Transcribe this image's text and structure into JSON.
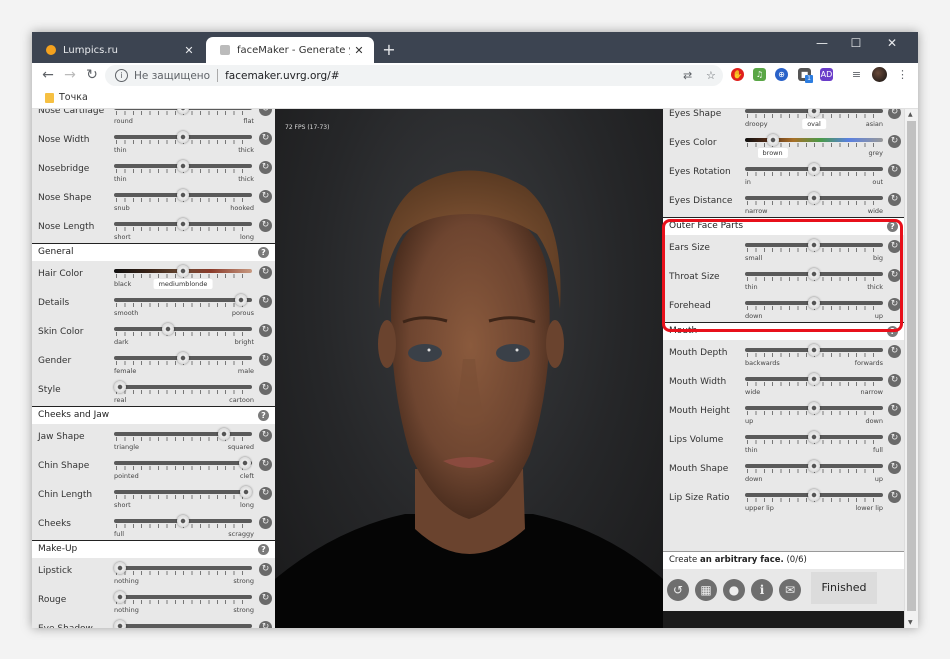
{
  "browser": {
    "tabs": [
      {
        "label": "Lumpics.ru",
        "favicon": "orange-circle-icon",
        "active": false
      },
      {
        "label": "faceMaker - Generate your favou",
        "favicon": "facemaker-icon",
        "active": true
      }
    ],
    "new_tab": "+",
    "window_controls": {
      "minimize": "—",
      "maximize": "☐",
      "close": "✕"
    },
    "nav": {
      "back": "←",
      "forward": "→",
      "reload": "↻"
    },
    "omnibox": {
      "security_icon": "ⓘ",
      "security_text": "Не защищено",
      "url": "facemaker.uvrg.org/#"
    },
    "toolbar_icons": [
      "translate-icon",
      "star-icon",
      "adblock-icon",
      "music-icon",
      "globe-icon",
      "cube-extension-icon",
      "ad-extension-icon",
      "media-control-icon",
      "profile-avatar",
      "menu-icon"
    ],
    "extension_badge": "1",
    "bookmarks": [
      {
        "label": "Точка"
      }
    ]
  },
  "viewport": {
    "fps": "72 FPS (17-73)"
  },
  "left_panel": {
    "sections": [
      {
        "title": null,
        "rows": [
          {
            "label": "Nose Cartilage",
            "min": "round",
            "max": "flat",
            "value": 0.5
          },
          {
            "label": "Nose Width",
            "min": "thin",
            "max": "thick",
            "value": 0.5
          },
          {
            "label": "Nosebridge",
            "min": "thin",
            "max": "thick",
            "value": 0.5
          },
          {
            "label": "Nose Shape",
            "min": "snub",
            "max": "hooked",
            "value": 0.5
          },
          {
            "label": "Nose Length",
            "min": "short",
            "max": "long",
            "value": 0.5
          }
        ]
      },
      {
        "title": "General",
        "rows": [
          {
            "label": "Hair Color",
            "min": "black",
            "max": "",
            "value": 0.5,
            "value_label": "mediumblonde",
            "gradient": "hair"
          },
          {
            "label": "Details",
            "min": "smooth",
            "max": "porous",
            "value": 0.92
          },
          {
            "label": "Skin Color",
            "min": "dark",
            "max": "bright",
            "value": 0.39
          },
          {
            "label": "Gender",
            "min": "female",
            "max": "male",
            "value": 0.5
          },
          {
            "label": "Style",
            "min": "real",
            "max": "cartoon",
            "value": 0.04
          }
        ]
      },
      {
        "title": "Cheeks and Jaw",
        "rows": [
          {
            "label": "Jaw Shape",
            "min": "triangle",
            "max": "squared",
            "value": 0.8
          },
          {
            "label": "Chin Shape",
            "min": "pointed",
            "max": "cleft",
            "value": 0.95
          },
          {
            "label": "Chin Length",
            "min": "short",
            "max": "long",
            "value": 0.96
          },
          {
            "label": "Cheeks",
            "min": "full",
            "max": "scraggy",
            "value": 0.5
          }
        ]
      },
      {
        "title": "Make-Up",
        "rows": [
          {
            "label": "Lipstick",
            "min": "nothing",
            "max": "strong",
            "value": 0.04
          },
          {
            "label": "Rouge",
            "min": "nothing",
            "max": "strong",
            "value": 0.04
          },
          {
            "label": "Eye Shadow",
            "min": "",
            "max": "",
            "value": 0.04
          }
        ]
      }
    ]
  },
  "right_panel": {
    "sections": [
      {
        "title": null,
        "rows": [
          {
            "label": "Eyes Shape",
            "min": "droopy",
            "max": "asian",
            "value": 0.5,
            "value_label": "oval"
          },
          {
            "label": "Eyes Color",
            "min": "",
            "max": "grey",
            "value": 0.2,
            "value_label": "brown",
            "gradient": "eyes"
          },
          {
            "label": "Eyes Rotation",
            "min": "in",
            "max": "out",
            "value": 0.5
          },
          {
            "label": "Eyes Distance",
            "min": "narrow",
            "max": "wide",
            "value": 0.5
          }
        ]
      },
      {
        "title": "Outer Face Parts",
        "highlighted": true,
        "rows": [
          {
            "label": "Ears Size",
            "min": "small",
            "max": "big",
            "value": 0.5
          },
          {
            "label": "Throat Size",
            "min": "thin",
            "max": "thick",
            "value": 0.5
          },
          {
            "label": "Forehead",
            "min": "down",
            "max": "up",
            "value": 0.5
          }
        ]
      },
      {
        "title": "Mouth",
        "rows": [
          {
            "label": "Mouth Depth",
            "min": "backwards",
            "max": "forwards",
            "value": 0.5
          },
          {
            "label": "Mouth Width",
            "min": "wide",
            "max": "narrow",
            "value": 0.5
          },
          {
            "label": "Mouth Height",
            "min": "up",
            "max": "down",
            "value": 0.5
          },
          {
            "label": "Lips Volume",
            "min": "thin",
            "max": "full",
            "value": 0.5
          },
          {
            "label": "Mouth Shape",
            "min": "down",
            "max": "up",
            "value": 0.5
          },
          {
            "label": "Lip Size Ratio",
            "min": "upper lip",
            "max": "lower lip",
            "value": 0.5
          }
        ]
      }
    ]
  },
  "task": {
    "prefix": "Create",
    "bold": "an arbitrary face.",
    "progress": "(0/6)"
  },
  "actions": {
    "buttons": [
      {
        "name": "undo-button",
        "icon": "↺"
      },
      {
        "name": "randomize-button",
        "icon": "▦"
      },
      {
        "name": "hint-button",
        "icon": "💡"
      },
      {
        "name": "info-button",
        "icon": "i"
      },
      {
        "name": "mail-button",
        "icon": "✉"
      }
    ],
    "finished_label": "Finished"
  },
  "colors": {
    "highlight": "#e8101b",
    "titlebar": "#3c4451"
  }
}
